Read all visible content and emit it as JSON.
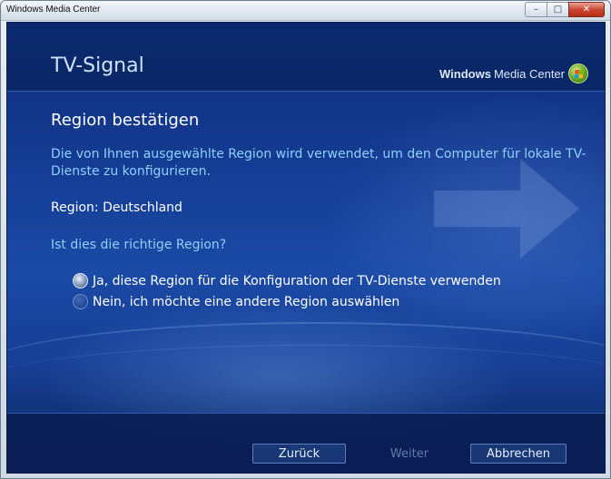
{
  "window": {
    "title": "Windows Media Center",
    "minimize_glyph": "–",
    "maximize_glyph": "□",
    "close_glyph": "✕"
  },
  "header": {
    "title": "TV-Signal",
    "brand_bold": "Windows",
    "brand_rest": "Media Center",
    "brand_icon": "windows-orb-icon"
  },
  "main": {
    "section_title": "Region bestätigen",
    "description": "Die von Ihnen ausgewählte Region wird verwendet, um den Computer für lokale TV-Dienste zu konfigurieren.",
    "region_text": "Region: Deutschland",
    "question": "Ist dies die richtige Region?",
    "options": [
      {
        "label": "Ja, diese Region für die Konfiguration der TV-Dienste verwenden",
        "selected": true
      },
      {
        "label": "Nein, ich möchte eine andere Region auswählen",
        "selected": false
      }
    ]
  },
  "footer": {
    "back_label": "Zurück",
    "next_label": "Weiter",
    "cancel_label": "Abbrechen"
  },
  "colors": {
    "background": "#143b92",
    "accent_text": "#8ed0ff",
    "title_text": "#cfe3ff"
  }
}
